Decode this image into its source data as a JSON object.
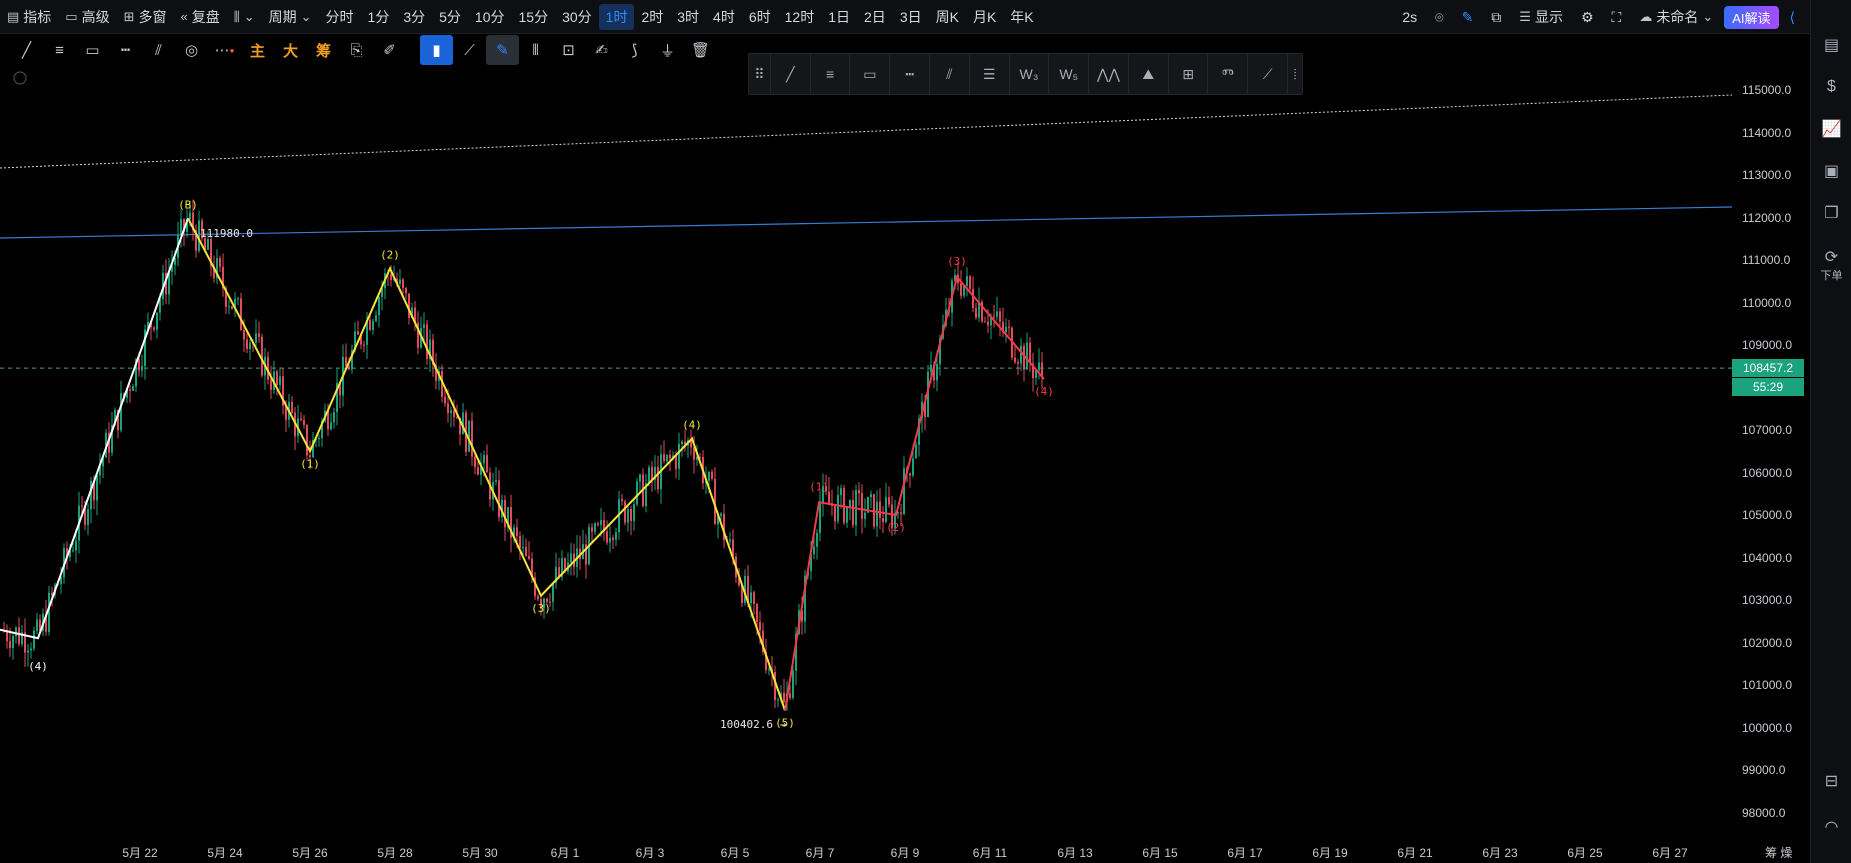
{
  "toolbar": {
    "items": [
      {
        "label": "指标",
        "icon": "indicator-icon"
      },
      {
        "label": "高级",
        "icon": "advanced-icon"
      },
      {
        "label": "多窗",
        "icon": "multi-window-icon"
      },
      {
        "label": "复盘",
        "icon": "replay-icon"
      },
      {
        "label": "",
        "icon": "chart-type-icon"
      },
      {
        "label": "周期",
        "icon": "chevron-down-icon"
      }
    ],
    "periods": [
      "分时",
      "1分",
      "3分",
      "5分",
      "10分",
      "15分",
      "30分",
      "1时",
      "2时",
      "3时",
      "4时",
      "6时",
      "12时",
      "1日",
      "2日",
      "3日",
      "周K",
      "月K",
      "年K"
    ],
    "active_period": "1时",
    "right": {
      "interval": "2s",
      "display": "显示",
      "layout_name": "未命名",
      "ai_label": "AI解读"
    }
  },
  "drawing_tools": [
    "trend-line",
    "horizontal-lines",
    "rectangle",
    "price-range",
    "parallel-channel",
    "fib-circle",
    "more",
    "主",
    "大",
    "筹",
    "magnet",
    "eraser-pen",
    "bookmark",
    "ruler",
    "brush",
    "bar-pattern",
    "lock",
    "note",
    "pen",
    "filter",
    "trash"
  ],
  "price_axis": {
    "ticks": [
      "115000.0",
      "114000.0",
      "113000.0",
      "112000.0",
      "111000.0",
      "110000.0",
      "109000.0",
      "108000.0",
      "107000.0",
      "106000.0",
      "105000.0",
      "104000.0",
      "103000.0",
      "102000.0",
      "101000.0",
      "100000.0",
      "99000.0",
      "98000.0"
    ],
    "current_price": "108457.2",
    "countdown": "55:29",
    "colors": {
      "up": "#1aa37c",
      "down": "#e34b5a",
      "wave_white": "#ffffff",
      "wave_yellow": "#f3e53b",
      "wave_red": "#ef3c4a",
      "trendline": "#3a7bd5"
    }
  },
  "time_axis": {
    "labels": [
      "5月 22",
      "5月 24",
      "5月 26",
      "5月 28",
      "5月 30",
      "6月 1",
      "6月 3",
      "6月 5",
      "6月 7",
      "6月 9",
      "6月 11",
      "6月 13",
      "6月 15",
      "6月 17",
      "6月 19",
      "6月 21",
      "6月 23",
      "6月 25",
      "6月 27"
    ],
    "right_label": "筹 燥"
  },
  "annotations": {
    "high_price": "111980.0",
    "low_price": "100402.6",
    "wave_labels_white": [
      "(4)"
    ],
    "wave_labels_yellow": [
      "(B)",
      "(1)",
      "(2)",
      "(3)",
      "(4)",
      "(5)"
    ],
    "wave_labels_red": [
      "(1)",
      "(2)",
      "(3)",
      "(4)"
    ]
  },
  "right_sidebar": {
    "order_label": "下单"
  },
  "chart_data": {
    "type": "candlestick",
    "ylim": [
      97500,
      115800
    ],
    "overlay_paths": [
      {
        "name": "white",
        "points": [
          [
            0,
            102200
          ],
          [
            1,
            102100
          ],
          [
            6,
            111980
          ]
        ]
      },
      {
        "name": "yellow",
        "points": [
          [
            6,
            111980
          ],
          [
            10,
            106600
          ],
          [
            13,
            110800
          ],
          [
            18,
            103100
          ],
          [
            23,
            106800
          ],
          [
            26,
            100400
          ]
        ]
      },
      {
        "name": "red",
        "points": [
          [
            26,
            100400
          ],
          [
            28,
            105300
          ],
          [
            30,
            105000
          ],
          [
            32,
            110600
          ],
          [
            35,
            108200
          ]
        ]
      }
    ]
  }
}
